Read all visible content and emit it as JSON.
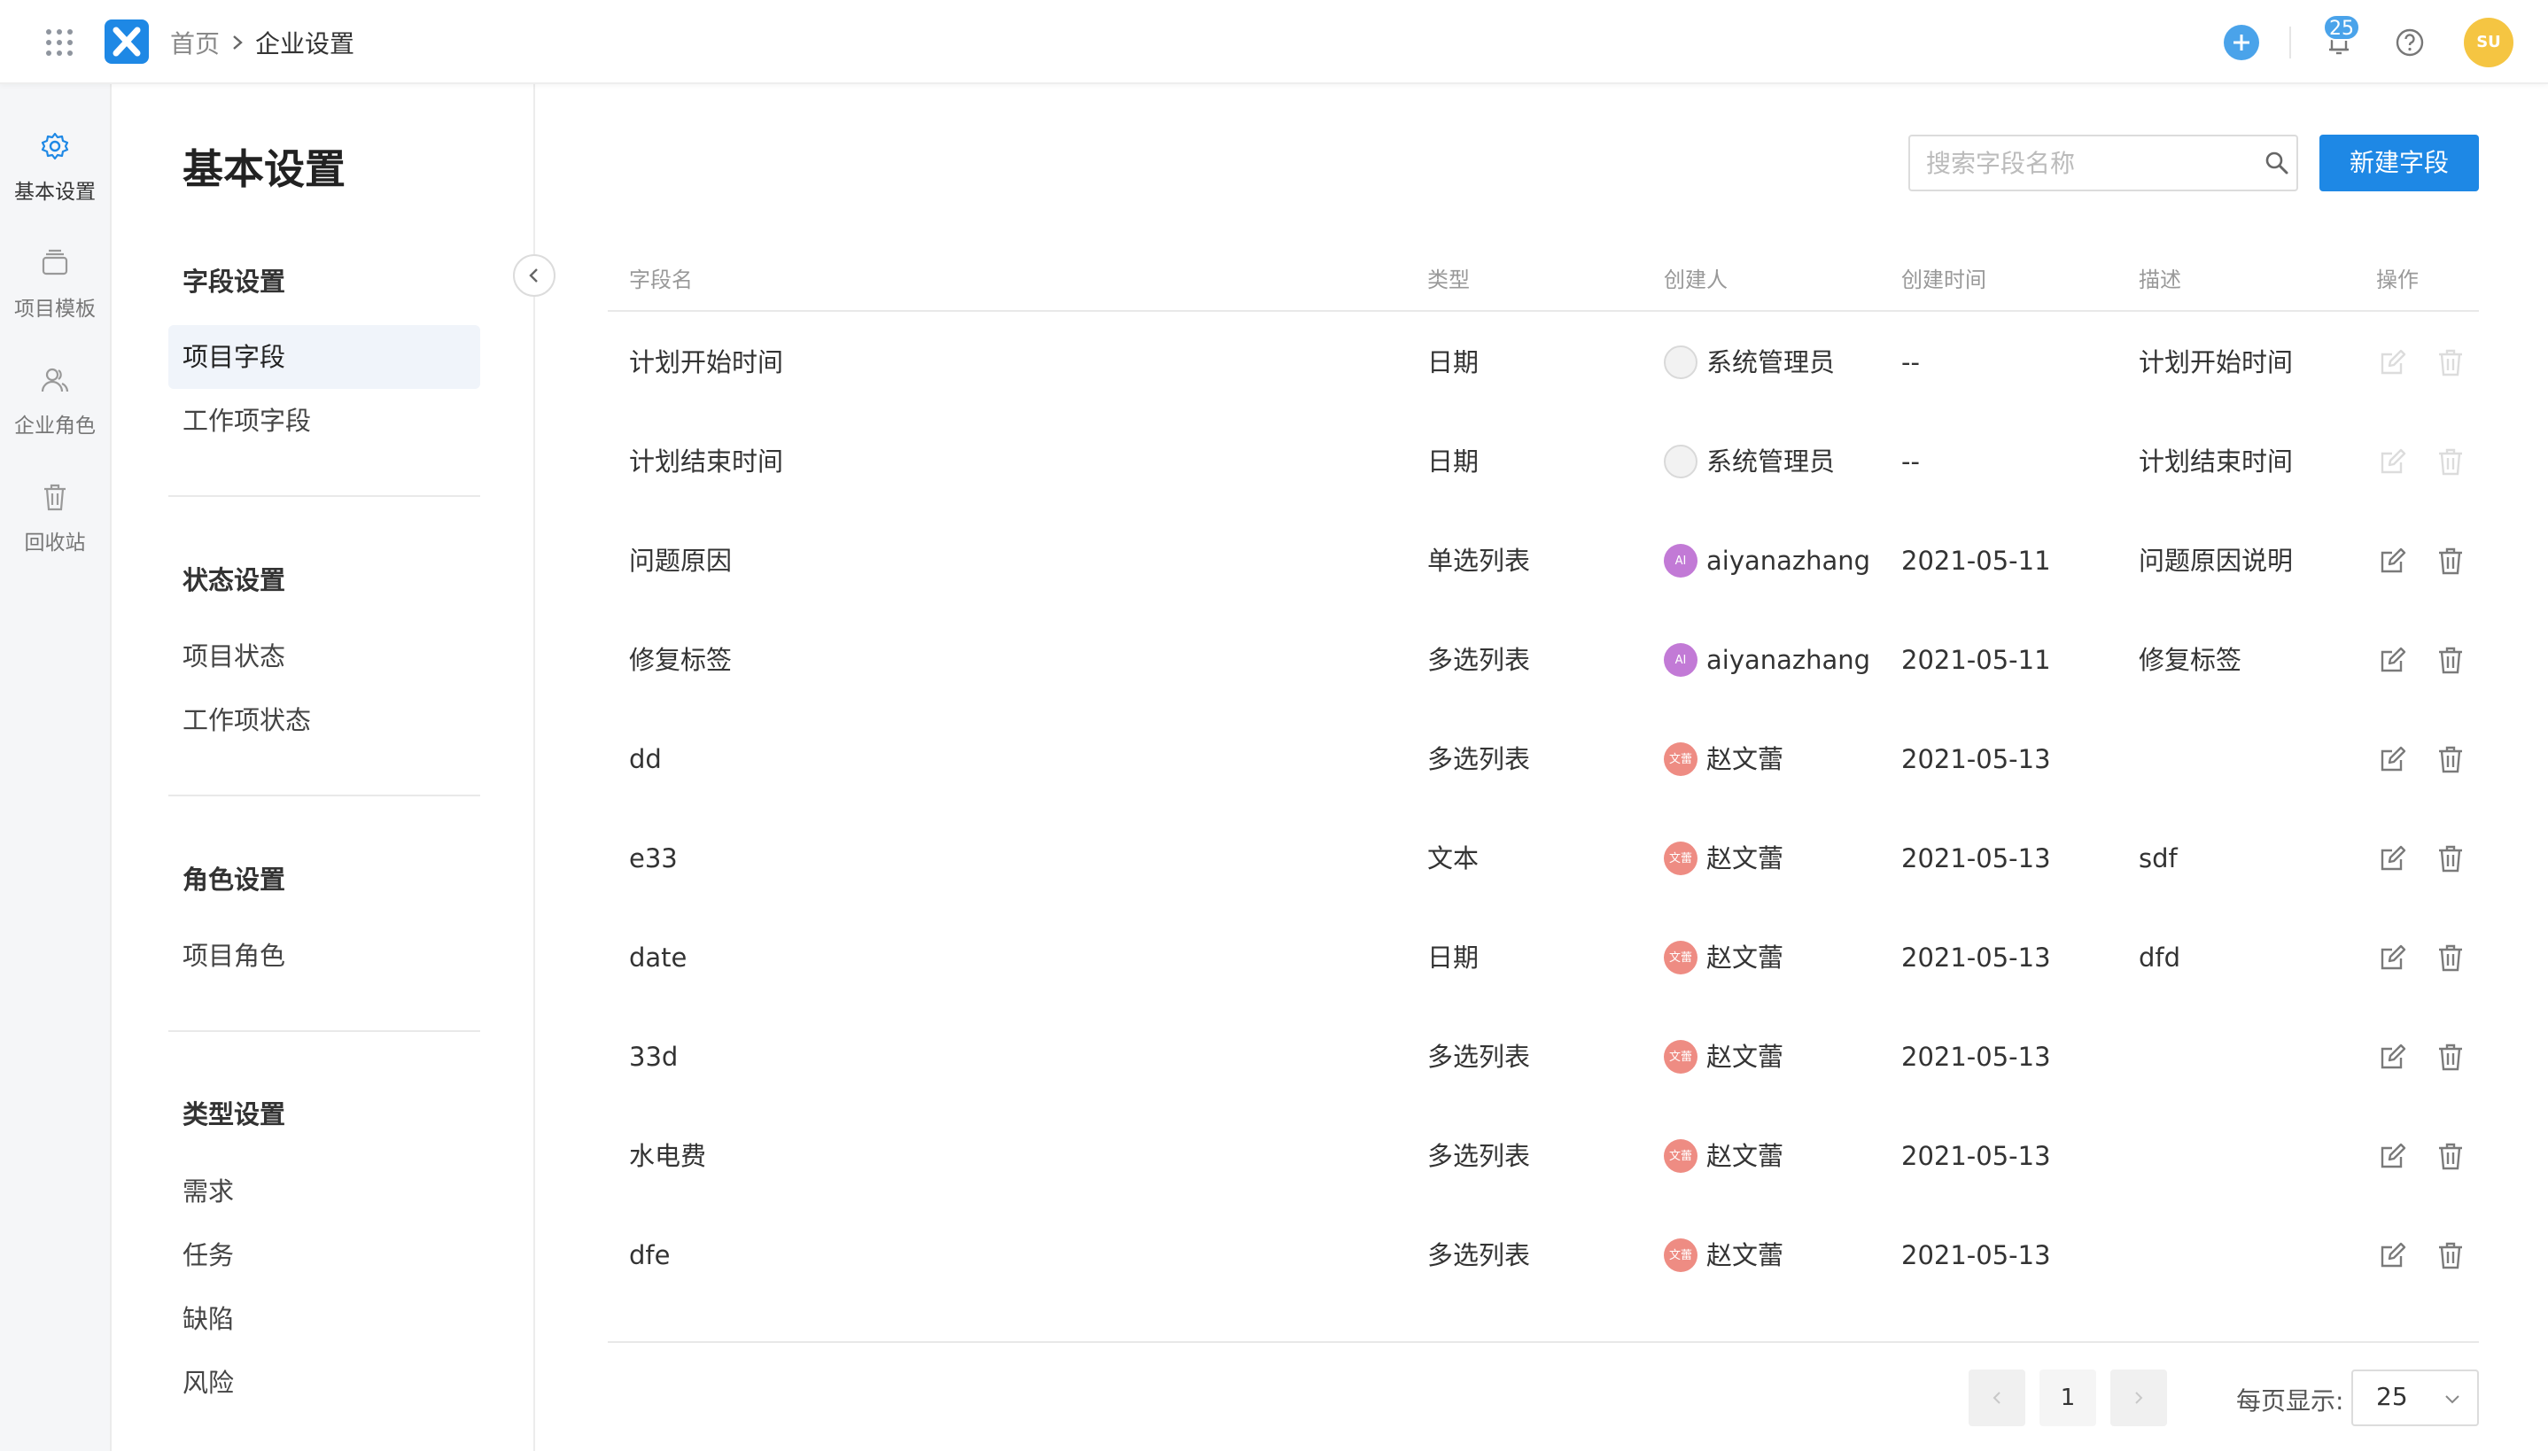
{
  "topbar": {
    "breadcrumb": {
      "home": "首页",
      "current": "企业设置"
    },
    "notification_count": "25",
    "user_initials": "SU"
  },
  "rail": {
    "items": [
      {
        "label": "基本设置",
        "icon": "gear-icon",
        "active": true
      },
      {
        "label": "项目模板",
        "icon": "template-icon",
        "active": false
      },
      {
        "label": "企业角色",
        "icon": "user-roles-icon",
        "active": false
      },
      {
        "label": "回收站",
        "icon": "trash-icon",
        "active": false
      }
    ]
  },
  "settings": {
    "title": "基本设置",
    "sections": [
      {
        "title": "字段设置",
        "items": [
          "项目字段",
          "工作项字段"
        ]
      },
      {
        "title": "状态设置",
        "items": [
          "项目状态",
          "工作项状态"
        ]
      },
      {
        "title": "角色设置",
        "items": [
          "项目角色"
        ]
      },
      {
        "title": "类型设置",
        "items": [
          "需求",
          "任务",
          "缺陷",
          "风险"
        ]
      }
    ],
    "active_item": "项目字段"
  },
  "toolbar": {
    "search_placeholder": "搜索字段名称",
    "new_button": "新建字段"
  },
  "table": {
    "columns": [
      "字段名",
      "类型",
      "创建人",
      "创建时间",
      "描述",
      "操作"
    ],
    "rows": [
      {
        "name": "计划开始时间",
        "type": "日期",
        "creator": "系统管理员",
        "avatar": "sys",
        "avatar_text": "",
        "created": "--",
        "desc": "计划开始时间",
        "editable": false
      },
      {
        "name": "计划结束时间",
        "type": "日期",
        "creator": "系统管理员",
        "avatar": "sys",
        "avatar_text": "",
        "created": "--",
        "desc": "计划结束时间",
        "editable": false
      },
      {
        "name": "问题原因",
        "type": "单选列表",
        "creator": "aiyanazhang",
        "avatar": "ai",
        "avatar_text": "AI",
        "created": "2021-05-11",
        "desc": "问题原因说明",
        "editable": true
      },
      {
        "name": "修复标签",
        "type": "多选列表",
        "creator": "aiyanazhang",
        "avatar": "ai",
        "avatar_text": "AI",
        "created": "2021-05-11",
        "desc": "修复标签",
        "editable": true
      },
      {
        "name": "dd",
        "type": "多选列表",
        "creator": "赵文蕾",
        "avatar": "wen",
        "avatar_text": "文蕾",
        "created": "2021-05-13",
        "desc": "",
        "editable": true
      },
      {
        "name": "e33",
        "type": "文本",
        "creator": "赵文蕾",
        "avatar": "wen",
        "avatar_text": "文蕾",
        "created": "2021-05-13",
        "desc": "sdf",
        "editable": true
      },
      {
        "name": "date",
        "type": "日期",
        "creator": "赵文蕾",
        "avatar": "wen",
        "avatar_text": "文蕾",
        "created": "2021-05-13",
        "desc": "dfd",
        "editable": true
      },
      {
        "name": "33d",
        "type": "多选列表",
        "creator": "赵文蕾",
        "avatar": "wen",
        "avatar_text": "文蕾",
        "created": "2021-05-13",
        "desc": "",
        "editable": true
      },
      {
        "name": "水电费",
        "type": "多选列表",
        "creator": "赵文蕾",
        "avatar": "wen",
        "avatar_text": "文蕾",
        "created": "2021-05-13",
        "desc": "",
        "editable": true
      },
      {
        "name": "dfe",
        "type": "多选列表",
        "creator": "赵文蕾",
        "avatar": "wen",
        "avatar_text": "文蕾",
        "created": "2021-05-13",
        "desc": "",
        "editable": true
      }
    ]
  },
  "pagination": {
    "current_page": "1",
    "per_page_label": "每页显示:",
    "per_page_value": "25"
  },
  "colors": {
    "primary": "#1e88e5",
    "accent_light": "#4aa3ea",
    "avatar_user": "#f5c542",
    "avatar_ai": "#c27ad6",
    "avatar_wen": "#ee8c83"
  }
}
